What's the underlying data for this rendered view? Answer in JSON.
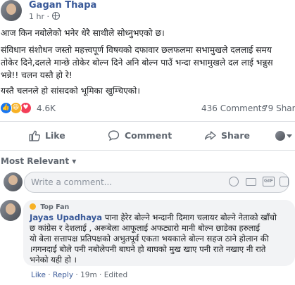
{
  "post": {
    "author": "Gagan Thapa",
    "time": "1 hr",
    "dot": "·",
    "lines": [
      "आज किन नबोलेको भनेर धेरै साथीले सोध्नुभएको छ।",
      "संविधान संशोधन जस्तो महत्त्वपूर्ण विषयको दफावार छलफलमा सभामुखले दललाई समय",
      "तोकेर दिने,दलले मान्छे तोकेर बोल्न दिने अनि बोल्न पाउँ भन्दा सभामुखले दल लाई भन्नुस",
      "भन्ने!! चलन यस्तै हो रे!",
      "यस्तै चलनले हो सांसदको भूमिका खुम्चिएको।"
    ]
  },
  "stats": {
    "reactions": "4.6K",
    "comments": "436 Comments",
    "shares": "79 Share"
  },
  "actions": {
    "like": "Like",
    "comment": "Comment",
    "share": "Share"
  },
  "filter": {
    "label": "Most Relevant",
    "arrow": "▾"
  },
  "input": {
    "placeholder": "Write a comment...",
    "gif": "GIF"
  },
  "comment": {
    "badge": "Top Fan",
    "author": "Jayas Upadhaya",
    "lines": [
      " पाना हेरेर बोल्ने भन्दानी दिमाग चलायर बोल्ने नेताको खाँचो",
      "छ कांग्रेस र देशलाई , अरूबेला आफूलाई अफट्यारो मानी बोल्न छाडेका हरुलाई",
      "यो बेला सत्तापक्ष प्रतिपक्षको अभुतपूर्व एकता भयकाले बोल्न सहज ठाने होलान की",
      "।गगनदाई बोले पनी नबोलेपनी बाघने हो बाघको मुख खाए पनी राते नखाए नी राते",
      "भनेको यही हो ।"
    ],
    "like": "Like",
    "reply": "Reply",
    "sep": "·",
    "time": "19m",
    "edited": "Edited"
  },
  "colors": {
    "link": "#385898",
    "muted": "#606770",
    "like": "#1877f2",
    "love": "#f33e58",
    "haha": "#f7b125"
  }
}
